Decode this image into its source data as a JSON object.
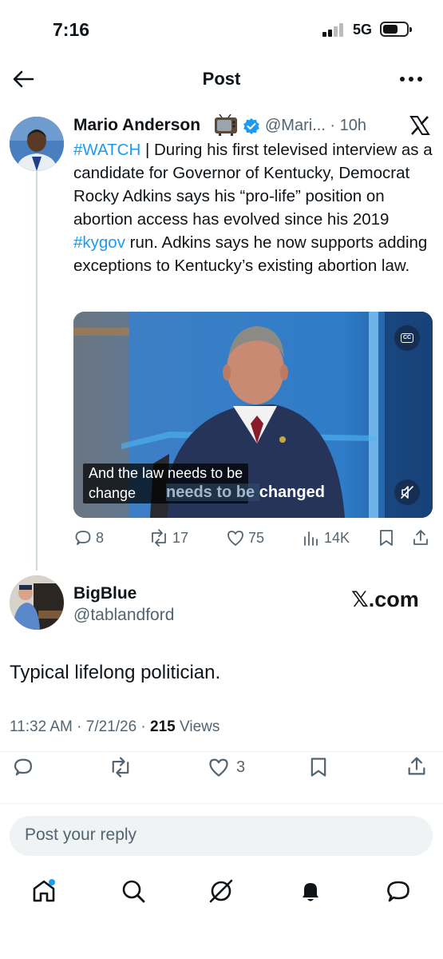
{
  "status_bar": {
    "time": "7:16",
    "network": "5G"
  },
  "header": {
    "title": "Post"
  },
  "quoted_post": {
    "author_name": "Mario Anderson",
    "handle": "@Mari...",
    "time_sep": "·",
    "time": "10h",
    "text_parts": {
      "hashtag_watch": "#WATCH",
      "body_1": " | During his first televised interview as a candidate for Governor of Kentucky, Democrat Rocky Adkins says his “pro-life” position on abortion access has evolved since his 2019 ",
      "hashtag_kygov": "#kygov",
      "body_2": " run. Adkins says he now supports adding exceptions to Kentucky’s existing abortion law."
    },
    "video": {
      "cc_label": "CC",
      "caption_line1": "And the law needs to be",
      "caption_line2": "change",
      "burned_dim": "needs to be ",
      "burned_bright": "changed"
    },
    "actions": {
      "replies": "8",
      "reposts": "17",
      "likes": "75",
      "views": "14K"
    }
  },
  "reply": {
    "author_name": "BigBlue",
    "handle": "@tablandford",
    "watermark": "𝕏.com",
    "text": "Typical lifelong politician.",
    "timestamp": "11:32 AM · 7/21/26 · ",
    "views_count": "215",
    "views_label": " Views",
    "likes": "3"
  },
  "composer": {
    "placeholder": "Post your reply"
  },
  "colors": {
    "link": "#1d9bf0",
    "muted": "#536471",
    "text": "#0f1419"
  }
}
